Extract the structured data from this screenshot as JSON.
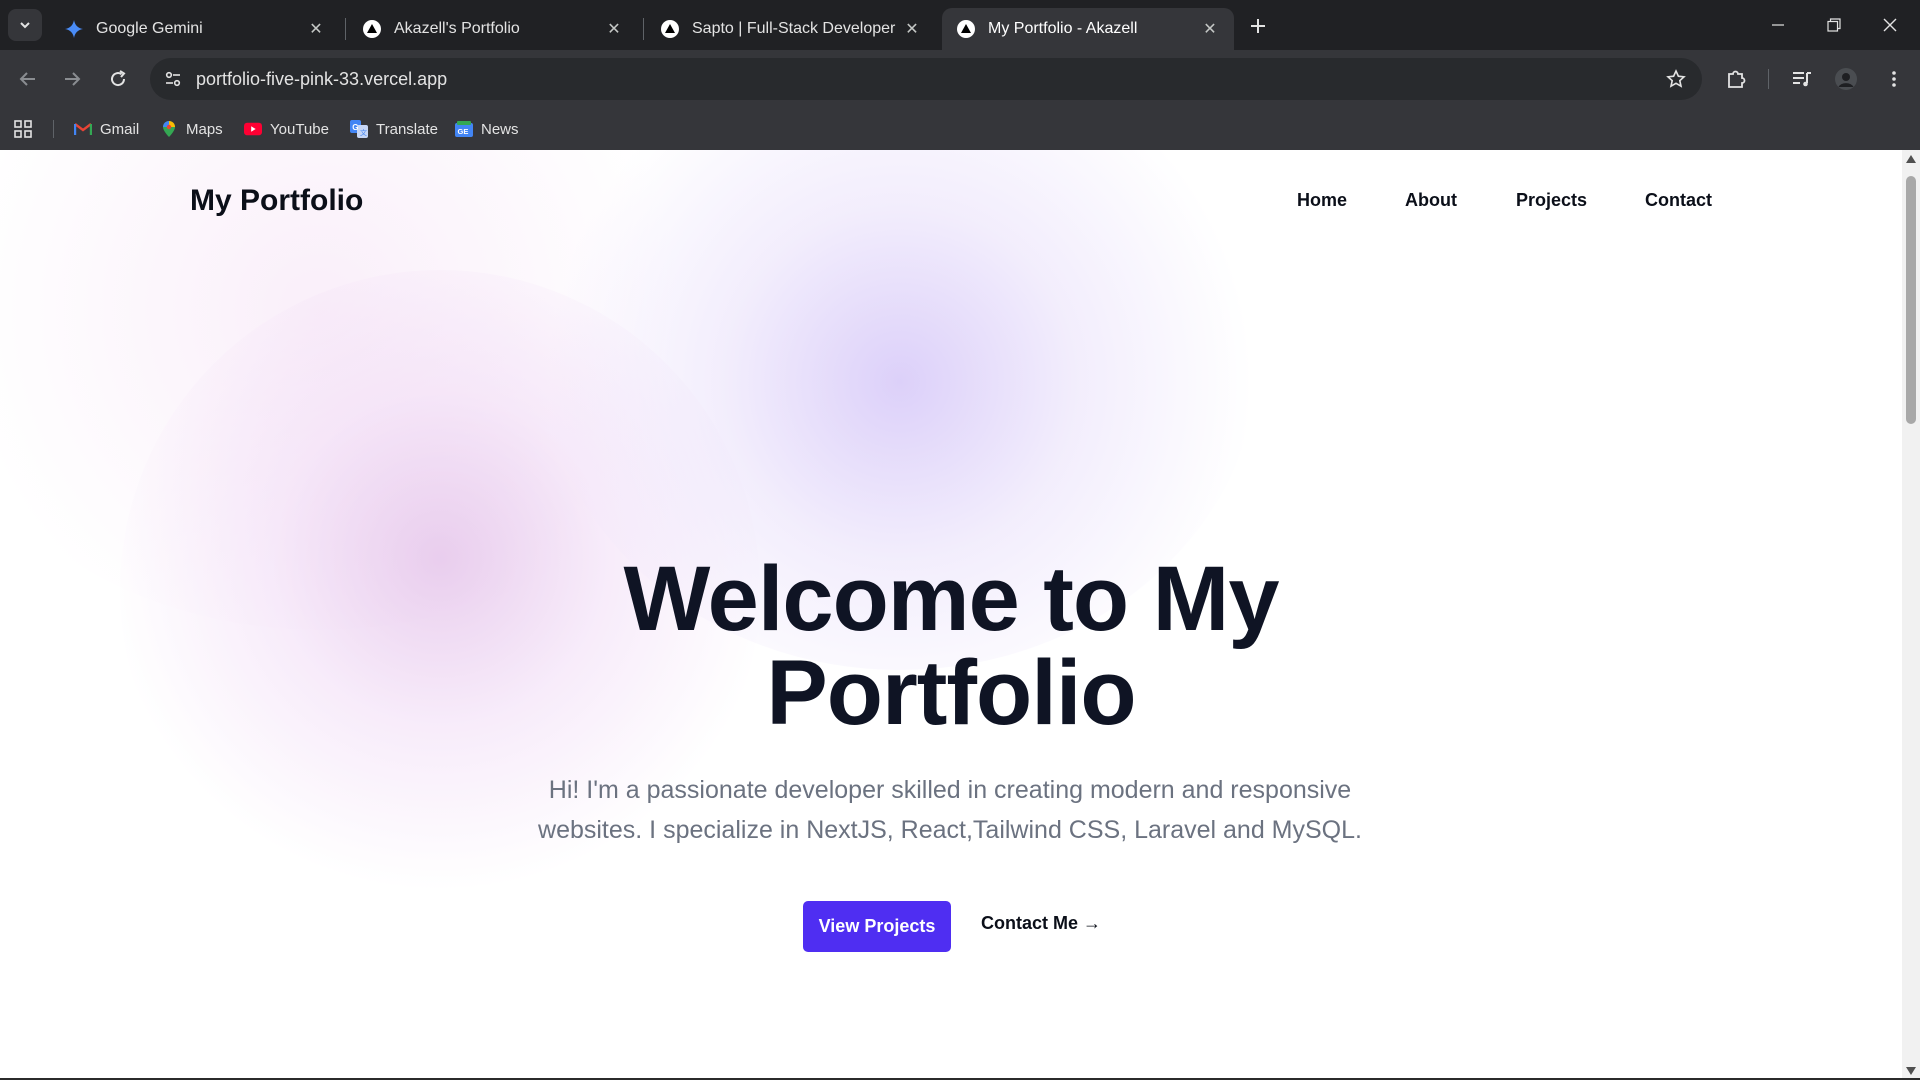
{
  "tabs": [
    {
      "title": "Google Gemini",
      "icon": "gemini-icon",
      "active": false
    },
    {
      "title": "Akazell's Portfolio",
      "icon": "vercel-icon",
      "active": false
    },
    {
      "title": "Sapto | Full-Stack Developer",
      "icon": "vercel-icon",
      "active": false
    },
    {
      "title": "My Portfolio - Akazell",
      "icon": "vercel-icon",
      "active": true
    }
  ],
  "toolbar": {
    "url": "portfolio-five-pink-33.vercel.app"
  },
  "bookmarks": [
    {
      "label": "Gmail",
      "icon": "gmail-icon"
    },
    {
      "label": "Maps",
      "icon": "maps-icon"
    },
    {
      "label": "YouTube",
      "icon": "youtube-icon"
    },
    {
      "label": "Translate",
      "icon": "translate-icon"
    },
    {
      "label": "News",
      "icon": "news-icon"
    }
  ],
  "page": {
    "brand": "My Portfolio",
    "nav": [
      "Home",
      "About",
      "Projects",
      "Contact"
    ],
    "hero": {
      "title_line1": "Welcome to My",
      "title_line2": "Portfolio",
      "subtitle_line1": "Hi! I'm a passionate developer skilled in creating modern and responsive",
      "subtitle_line2": "websites. I specialize in NextJS, React,Tailwind CSS, Laravel and MySQL.",
      "primary_button": "View Projects",
      "secondary_button": "Contact Me →"
    }
  },
  "colors": {
    "primary_button": "#4f2ef2",
    "heading": "#0f1424",
    "subtitle": "#6b7280"
  }
}
